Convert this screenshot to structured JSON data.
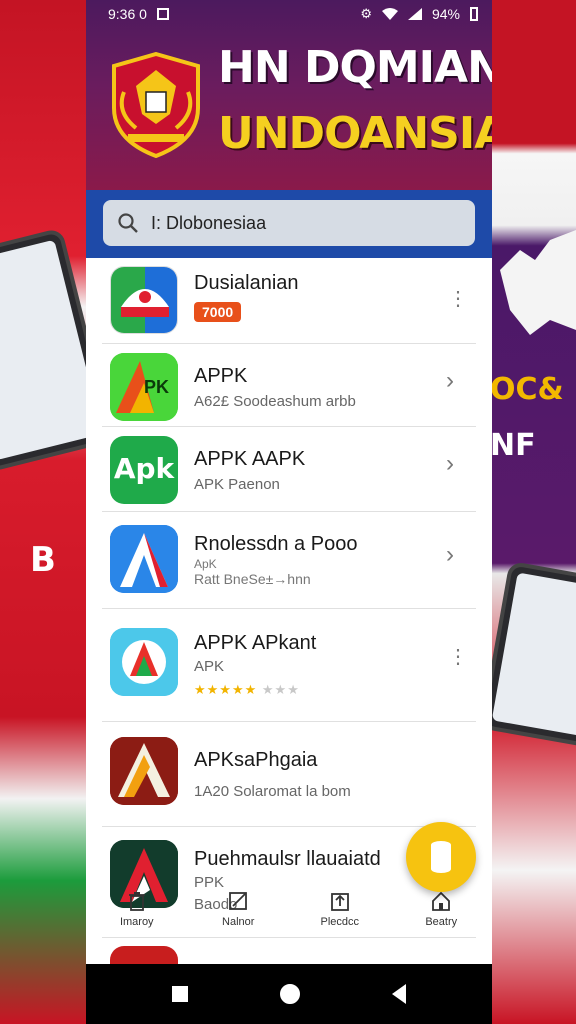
{
  "status_bar": {
    "time": "9:36 0",
    "battery": "94%"
  },
  "header": {
    "title_line1": "HN DQMIAN",
    "title_line2": "UNDOANSIA"
  },
  "search": {
    "value": "I: Dlobonesiaa"
  },
  "apps": [
    {
      "name": "Dusialanian",
      "badge": "7000",
      "action_icon": "more-vert-icon"
    },
    {
      "name": "APPK",
      "subtitle": "A62£ Soodeashum arbb",
      "action_icon": "chevron-right-icon"
    },
    {
      "name": "APPK AAPK",
      "subtitle": "APK Paenon",
      "icon_text": "Apk",
      "action_icon": "chevron-right-icon"
    },
    {
      "name": "Rnolessdn a Pooo",
      "subtitle": "ApK",
      "subtitle2": "Ratt BneSe±→hnn",
      "action_icon": "chevron-right-icon"
    },
    {
      "name": "APPK APkant",
      "subtitle": "APK",
      "rating": "★★★★★",
      "rating_faded": "★★★",
      "action_icon": "more-vert-icon"
    },
    {
      "name": "APKsaPhgaia",
      "subtitle": "1A20 Solaromat la bom"
    },
    {
      "name": "Puehmaulsr llauaiatd",
      "subtitle": "PPK",
      "subtitle2": "Baodo"
    }
  ],
  "bottom_nav": [
    {
      "label": "Imaroy",
      "icon": "trash-icon"
    },
    {
      "label": "Nalnor",
      "icon": "edit-icon"
    },
    {
      "label": "Plecdcc",
      "icon": "upload-icon"
    },
    {
      "label": "Beatry",
      "icon": "home-icon"
    }
  ],
  "fab": {
    "icon": "cylinder-icon"
  },
  "colors": {
    "header_top": "#4c1a5e",
    "header_bottom": "#8a1a4a",
    "search_band": "#1e4aa8",
    "title_accent": "#f5d020",
    "fab": "#f6c310",
    "badge": "#e8501a"
  }
}
